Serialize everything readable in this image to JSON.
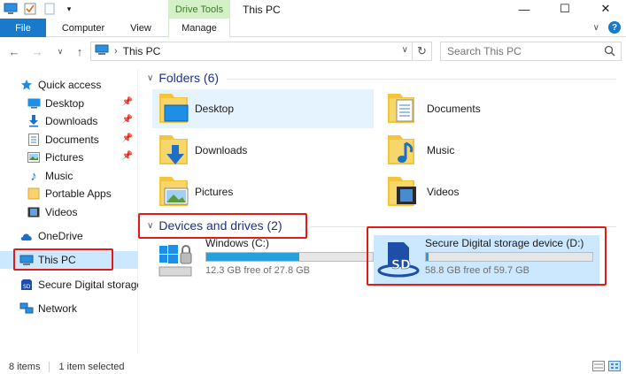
{
  "window": {
    "title": "This PC",
    "contextual_group": "Drive Tools"
  },
  "ribbon": {
    "tabs": [
      {
        "label": "File"
      },
      {
        "label": "Computer"
      },
      {
        "label": "View"
      },
      {
        "label": "Manage"
      }
    ]
  },
  "address": {
    "location": "This PC",
    "search_placeholder": "Search This PC"
  },
  "sidebar": {
    "items": [
      {
        "label": "Quick access",
        "icon": "star-icon"
      },
      {
        "label": "Desktop",
        "icon": "desktop-icon",
        "pinned": true
      },
      {
        "label": "Downloads",
        "icon": "download-icon",
        "pinned": true
      },
      {
        "label": "Documents",
        "icon": "documents-icon",
        "pinned": true
      },
      {
        "label": "Pictures",
        "icon": "pictures-icon",
        "pinned": true
      },
      {
        "label": "Music",
        "icon": "music-icon"
      },
      {
        "label": "Portable Apps",
        "icon": "folder-icon"
      },
      {
        "label": "Videos",
        "icon": "videos-icon"
      },
      {
        "label": "OneDrive",
        "icon": "cloud-icon"
      },
      {
        "label": "This PC",
        "icon": "computer-icon",
        "selected": true
      },
      {
        "label": "Secure Digital storage",
        "icon": "sd-card-icon"
      },
      {
        "label": "Network",
        "icon": "network-icon"
      }
    ]
  },
  "folders": {
    "heading": "Folders (6)",
    "items": [
      {
        "label": "Desktop",
        "icon": "desktop-folder-icon"
      },
      {
        "label": "Documents",
        "icon": "documents-folder-icon"
      },
      {
        "label": "Downloads",
        "icon": "downloads-folder-icon"
      },
      {
        "label": "Music",
        "icon": "music-folder-icon"
      },
      {
        "label": "Pictures",
        "icon": "pictures-folder-icon"
      },
      {
        "label": "Videos",
        "icon": "videos-folder-icon"
      }
    ]
  },
  "devices": {
    "heading": "Devices and drives (2)",
    "items": [
      {
        "name": "Windows (C:)",
        "free": "12.3 GB free of 27.8 GB",
        "used_fraction": 0.56,
        "icon": "windows-drive-icon"
      },
      {
        "name": "Secure Digital storage device (D:)",
        "free": "58.8 GB free of 59.7 GB",
        "used_fraction": 0.015,
        "icon": "sd-drive-icon"
      }
    ]
  },
  "status": {
    "items_count": "8 items",
    "selection": "1 item selected"
  },
  "colors": {
    "accent": "#1979ca",
    "selection": "#cce8ff",
    "heading": "#1e3287",
    "annotation": "#e31a1a",
    "bar_fill": "#26a0da"
  }
}
